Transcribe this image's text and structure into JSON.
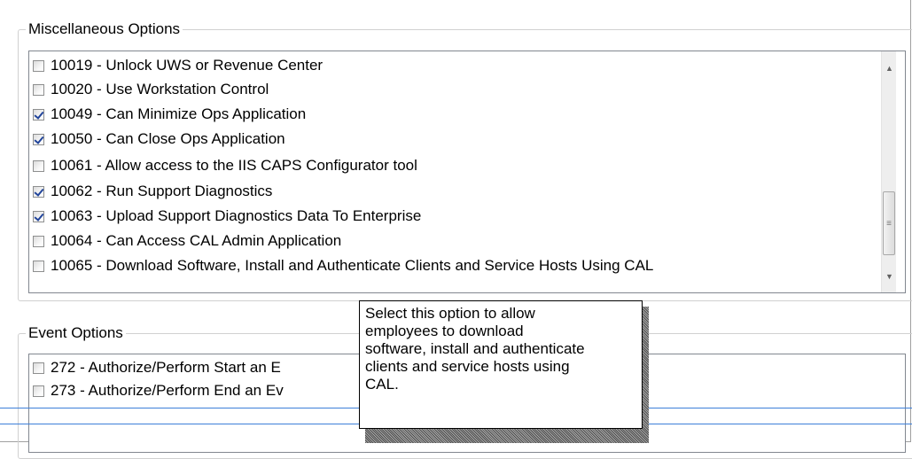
{
  "misc_options": {
    "title": "Miscellaneous Options",
    "items": [
      {
        "label": "10019 - Unlock UWS or Revenue Center",
        "checked": false
      },
      {
        "label": "10020 - Use Workstation Control",
        "checked": false
      },
      {
        "label": "10049 - Can Minimize Ops Application",
        "checked": true
      },
      {
        "label": "10050 - Can Close Ops Application",
        "checked": true
      },
      {
        "label": "10061 - Allow access to the IIS CAPS Configurator tool",
        "checked": false
      },
      {
        "label": "10062 - Run Support Diagnostics",
        "checked": true
      },
      {
        "label": "10063 - Upload Support Diagnostics Data To Enterprise",
        "checked": true
      },
      {
        "label": "10064 - Can Access CAL Admin Application",
        "checked": false
      },
      {
        "label": "10065 -  Download Software, Install and Authenticate Clients and Service Hosts Using CAL",
        "checked": false
      }
    ],
    "scroll_up_icon": "▲",
    "scroll_down_icon": "▼",
    "thumb_grip_icon": "≡"
  },
  "event_options": {
    "title": "Event Options",
    "items": [
      {
        "label": "272 - Authorize/Perform Start an E",
        "checked": false
      },
      {
        "label": "273 - Authorize/Perform End an Ev",
        "checked": false
      }
    ]
  },
  "tooltip": {
    "lines": [
      "Select this option to allow",
      "employees to download",
      "software, install and authenticate",
      "clients and service hosts using",
      "CAL."
    ]
  },
  "colors": {
    "check": "#21449a",
    "divider": "#3d7fd9"
  }
}
